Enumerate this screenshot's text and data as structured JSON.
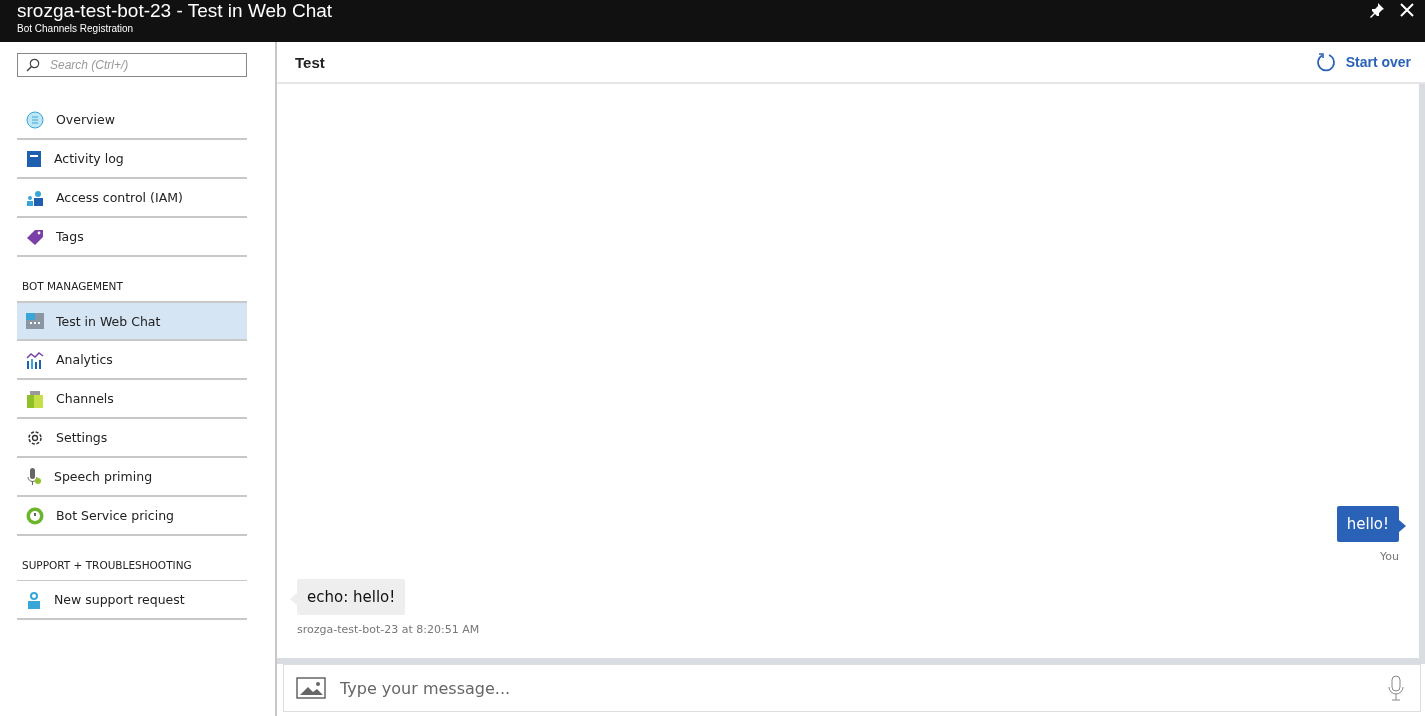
{
  "window": {
    "title": "srozga-test-bot-23 - Test in Web Chat",
    "subtitle": "Bot Channels Registration"
  },
  "sidebar": {
    "search": {
      "placeholder": "Search (Ctrl+/)"
    },
    "groups": [
      {
        "items": [
          {
            "label": "Overview",
            "selected": false
          },
          {
            "label": "Activity log",
            "selected": false
          },
          {
            "label": "Access control (IAM)",
            "selected": false
          },
          {
            "label": "Tags",
            "selected": false
          }
        ]
      },
      {
        "heading": "BOT MANAGEMENT",
        "items": [
          {
            "label": "Test in Web Chat",
            "selected": true
          },
          {
            "label": "Analytics",
            "selected": false
          },
          {
            "label": "Channels",
            "selected": false
          },
          {
            "label": "Settings",
            "selected": false
          },
          {
            "label": "Speech priming",
            "selected": false
          },
          {
            "label": "Bot Service pricing",
            "selected": false
          }
        ]
      },
      {
        "heading": "SUPPORT + TROUBLESHOOTING",
        "items": [
          {
            "label": "New support request",
            "selected": false
          }
        ]
      }
    ]
  },
  "panel": {
    "title": "Test",
    "start_over": "Start over"
  },
  "messages": [
    {
      "kind": "user",
      "text": "hello!",
      "meta": "You"
    },
    {
      "kind": "bot",
      "text": "echo: hello!",
      "meta": "srozga-test-bot-23 at 8:20:51 AM"
    }
  ],
  "composer": {
    "placeholder": "Type your message..."
  }
}
